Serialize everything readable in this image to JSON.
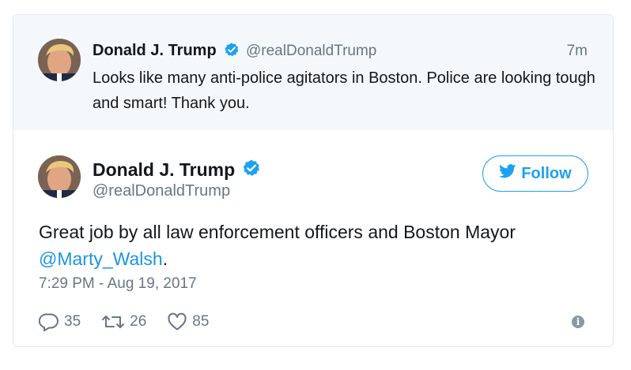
{
  "quoted_tweet": {
    "name": "Donald J. Trump",
    "handle": "@realDonaldTrump",
    "time": "7m",
    "text": "Looks like many anti-police agitators in Boston. Police are looking tough and smart! Thank you."
  },
  "main_tweet": {
    "name": "Donald J. Trump",
    "handle": "@realDonaldTrump",
    "follow_label": "Follow",
    "text": "Great job by all law enforcement officers and Boston Mayor ",
    "mention": "@Marty_Walsh",
    "text_end": ".",
    "timestamp": "7:29 PM - Aug 19, 2017"
  },
  "actions": {
    "replies": "35",
    "retweets": "26",
    "likes": "85"
  },
  "colors": {
    "accent": "#1da1f2",
    "muted": "#657786",
    "quoted_bg": "#f5f8fa"
  },
  "icons": [
    "verified-badge-icon",
    "twitter-bird-icon",
    "reply-icon",
    "retweet-icon",
    "heart-icon",
    "info-icon"
  ]
}
